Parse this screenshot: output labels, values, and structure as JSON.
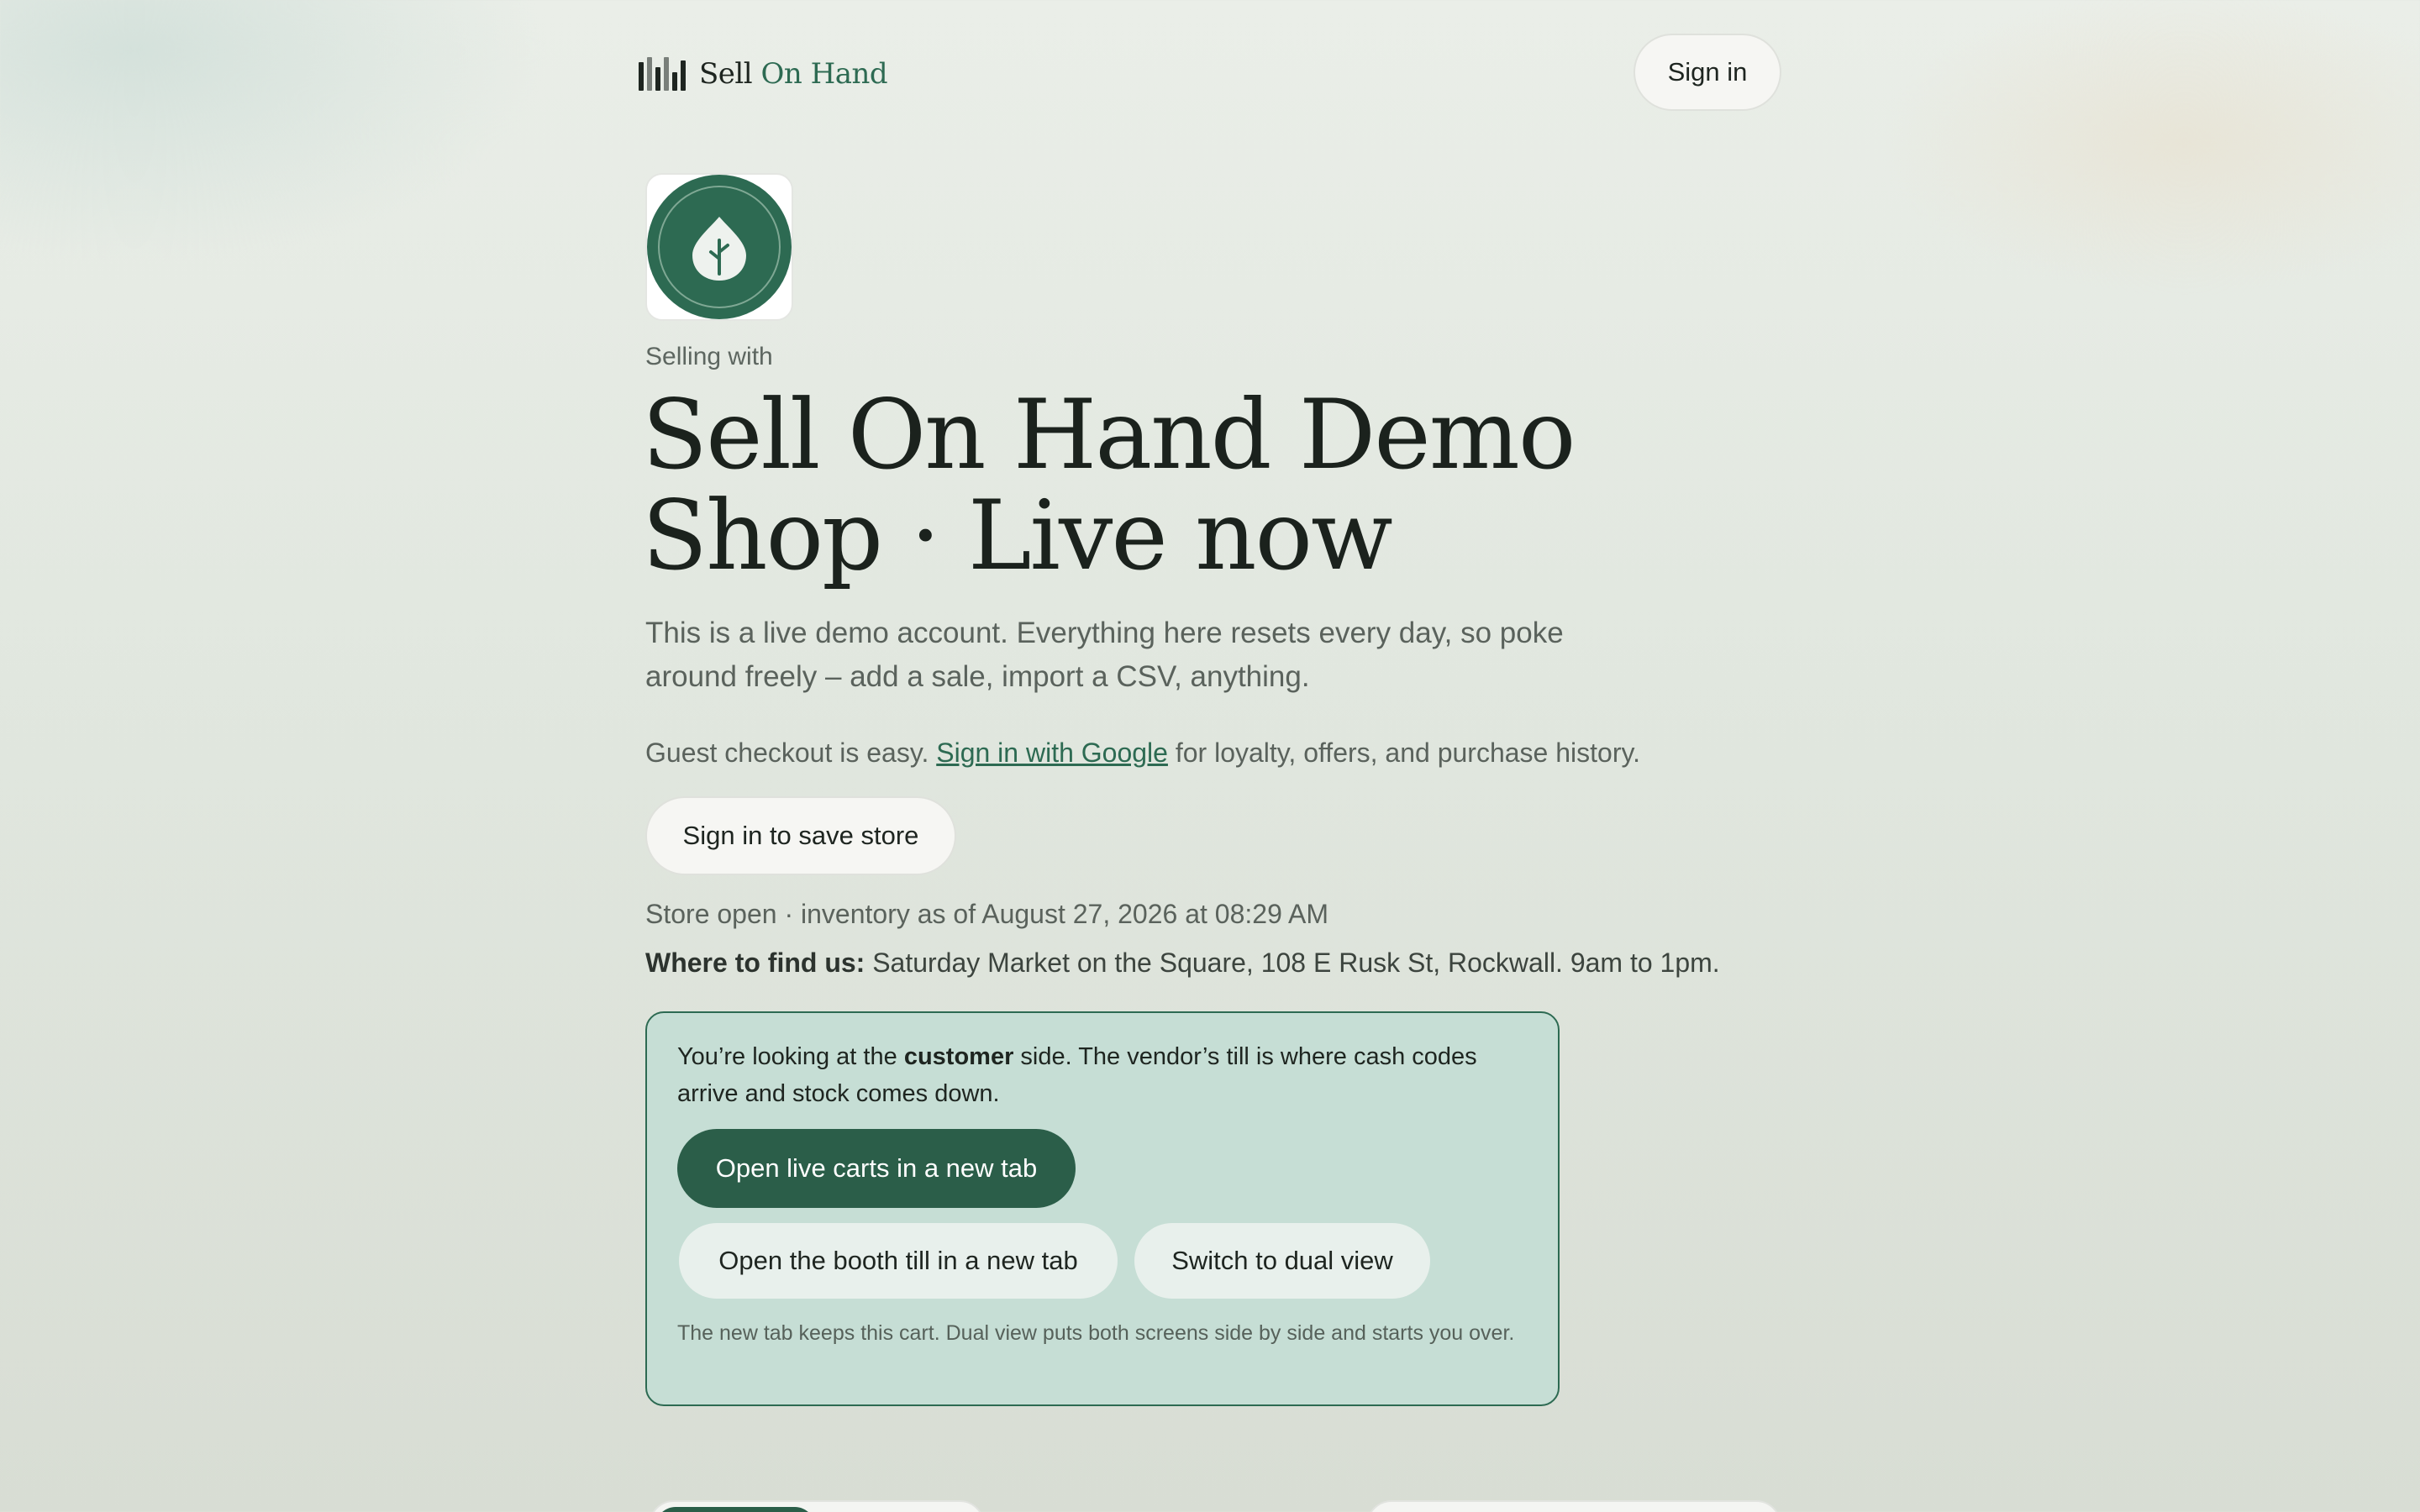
{
  "header": {
    "brand_primary": "Sell",
    "brand_accent": "On Hand",
    "sign_in_label": "Sign in"
  },
  "store": {
    "logo_icon": "leaf-sprout-icon",
    "eyebrow": "Selling with",
    "title_line1": "Sell On Hand Demo",
    "title_line2": "Shop · Live now",
    "intro": "This is a live demo account. Everything here resets every day, so poke around freely – add a sale, import a CSV, anything.",
    "guest_prefix": "Guest checkout is easy.",
    "guest_link": "Sign in with Google",
    "guest_suffix": "for loyalty, offers, and purchase history.",
    "save_store_label": "Sign in to save store",
    "status": "Store open · inventory as of August 27, 2026 at 08:29 AM",
    "find_us_label": "Where to find us:",
    "find_us_value": "Saturday Market on the Square, 108 E Rusk St, Rockwall. 9am to 1pm."
  },
  "panel": {
    "text_prefix": "You’re looking at the",
    "text_bold": "customer",
    "text_suffix": "side. The vendor’s till is where cash codes arrive and stock comes down.",
    "live_carts_label": "Open live carts in a new tab",
    "booth_till_label": "Open the booth till in a new tab",
    "dual_view_label": "Switch to dual view",
    "note": "The new tab keeps this cart. Dual view puts both screens side by side and starts you over."
  },
  "colors": {
    "accent": "#2d6a52",
    "button_primary": "#2b5e49",
    "panel_background": "#c6ded5",
    "text_primary": "#1e2520",
    "text_muted": "#5a625c"
  }
}
